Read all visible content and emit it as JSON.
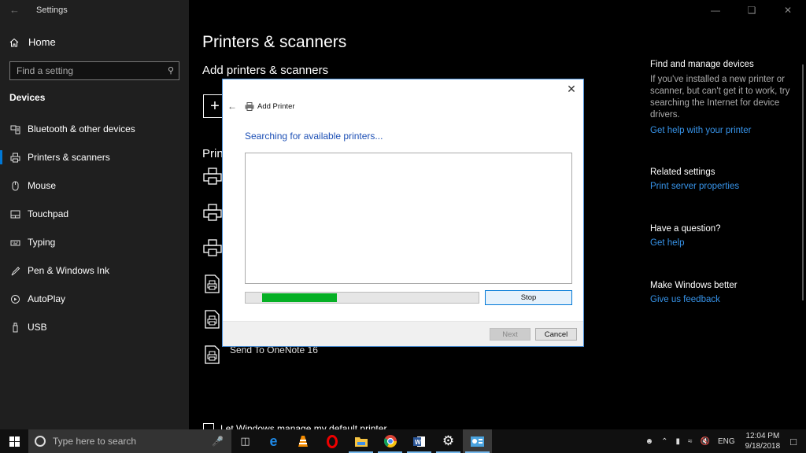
{
  "window": {
    "app_title": "Settings",
    "controls": [
      "minimize",
      "restore",
      "close"
    ]
  },
  "sidebar": {
    "home_label": "Home",
    "search_placeholder": "Find a setting",
    "section_title": "Devices",
    "items": [
      {
        "label": "Bluetooth & other devices",
        "icon": "bluetooth-devices-icon",
        "active": false
      },
      {
        "label": "Printers & scanners",
        "icon": "printer-icon",
        "active": true
      },
      {
        "label": "Mouse",
        "icon": "mouse-icon",
        "active": false
      },
      {
        "label": "Touchpad",
        "icon": "touchpad-icon",
        "active": false
      },
      {
        "label": "Typing",
        "icon": "keyboard-icon",
        "active": false
      },
      {
        "label": "Pen & Windows Ink",
        "icon": "pen-icon",
        "active": false
      },
      {
        "label": "AutoPlay",
        "icon": "autoplay-icon",
        "active": false
      },
      {
        "label": "USB",
        "icon": "usb-icon",
        "active": false
      }
    ]
  },
  "main": {
    "page_title": "Printers & scanners",
    "add_title": "Add printers & scanners",
    "printers_heading": "Prin",
    "printers": [
      {
        "name": "",
        "icon": "printer-icon"
      },
      {
        "name": "",
        "icon": "printer-icon"
      },
      {
        "name": "",
        "icon": "printer-icon"
      },
      {
        "name": "",
        "icon": "document-printer-icon"
      },
      {
        "name": "",
        "icon": "document-printer-icon"
      },
      {
        "name": "Send To OneNote 16",
        "icon": "document-printer-icon"
      }
    ],
    "default_checkbox_label": "Let Windows manage my default printer"
  },
  "related": {
    "find_title": "Find and manage devices",
    "find_desc": "If you've installed a new printer or scanner, but can't get it to work, try searching the Internet for device drivers.",
    "find_link": "Get help with your printer",
    "related_title": "Related settings",
    "related_link": "Print server properties",
    "question_title": "Have a question?",
    "question_link": "Get help",
    "better_title": "Make Windows better",
    "better_link": "Give us feedback"
  },
  "dialog": {
    "title": "Add Printer",
    "status": "Searching for available printers...",
    "progress_percent": 32,
    "progress_offset_percent": 7,
    "stop_label": "Stop",
    "next_label": "Next",
    "cancel_label": "Cancel"
  },
  "taskbar": {
    "search_placeholder": "Type here to search",
    "apps": [
      {
        "name": "edge",
        "running": false
      },
      {
        "name": "vlc",
        "running": false
      },
      {
        "name": "opera",
        "running": false
      },
      {
        "name": "file-explorer",
        "running": true
      },
      {
        "name": "chrome",
        "running": true
      },
      {
        "name": "word",
        "running": true
      },
      {
        "name": "settings",
        "running": true
      },
      {
        "name": "control-panel",
        "running": true
      }
    ],
    "language": "ENG",
    "time": "12:04 PM",
    "date": "9/18/2018"
  }
}
